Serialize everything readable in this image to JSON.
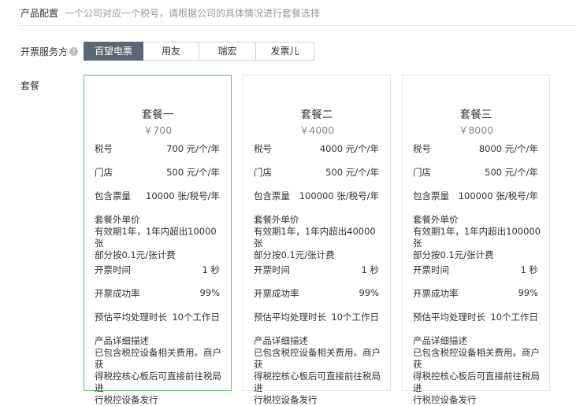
{
  "header": {
    "title": "产品配置",
    "desc": "一个公司对应一个税号，请根据公司的具体情况进行套餐选择"
  },
  "service": {
    "label": "开票服务方",
    "help": "?",
    "options": [
      "百望电票",
      "用友",
      "瑞宏",
      "发票儿"
    ],
    "selected": "百望电票"
  },
  "packages_label": "套餐",
  "colors": {
    "active_tab": "#5c6775",
    "selected_border": "#57c26a"
  },
  "packages": [
    {
      "name": "套餐一",
      "price": "￥700",
      "tax_label": "税号",
      "tax_value": "700 元/个/年",
      "store_label": "门店",
      "store_value": "500 元/个/年",
      "tickets_label": "包含票量",
      "tickets_value": "10000 张/税号/年",
      "extra_title": "套餐外单价",
      "extra_l1": "有效期1年，1年内超出10000张",
      "extra_l2": "部分按0.1元/张计费",
      "time_label": "开票时间",
      "time_value": "1 秒",
      "rate_label": "开票成功率",
      "rate_value": "99%",
      "proc_label": "预估平均处理时长",
      "proc_value": "10个工作日",
      "detail_title": "产品详细描述",
      "detail_l1": "已包含税控设备相关费用。商户获",
      "detail_l2": "得税控核心板后可直接前往税局进",
      "detail_l3": "行税控设备发行"
    },
    {
      "name": "套餐二",
      "price": "￥4000",
      "tax_label": "税号",
      "tax_value": "4000 元/个/年",
      "store_label": "门店",
      "store_value": "500 元/个/年",
      "tickets_label": "包含票量",
      "tickets_value": "100000 张/税号/年",
      "extra_title": "套餐外单价",
      "extra_l1": "有效期1年，1年内超出40000张",
      "extra_l2": "部分按0.1元/张计费",
      "time_label": "开票时间",
      "time_value": "1 秒",
      "rate_label": "开票成功率",
      "rate_value": "99%",
      "proc_label": "预估平均处理时长",
      "proc_value": "10个工作日",
      "detail_title": "产品详细描述",
      "detail_l1": "已包含税控设备相关费用。商户获",
      "detail_l2": "得税控核心板后可直接前往税局进",
      "detail_l3": "行税控设备发行"
    },
    {
      "name": "套餐三",
      "price": "￥8000",
      "tax_label": "税号",
      "tax_value": "8000 元/个/年",
      "store_label": "门店",
      "store_value": "500 元/个/年",
      "tickets_label": "包含票量",
      "tickets_value": "100000 张/税号/年",
      "extra_title": "套餐外单价",
      "extra_l1": "有效期1年，1年内超出100000张",
      "extra_l2": "部分按0.1元/张计费",
      "time_label": "开票时间",
      "time_value": "1 秒",
      "rate_label": "开票成功率",
      "rate_value": "99%",
      "proc_label": "预估平均处理时长",
      "proc_value": "10个工作日",
      "detail_title": "产品详细描述",
      "detail_l1": "已包含税控设备相关费用。商户获",
      "detail_l2": "得税控核心板后可直接前往税局进",
      "detail_l3": "行税控设备发行"
    }
  ]
}
